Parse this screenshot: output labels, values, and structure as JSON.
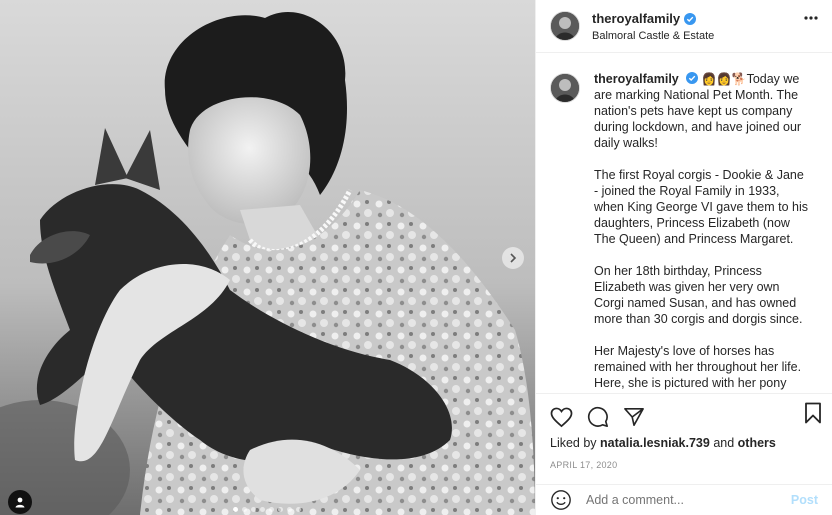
{
  "header": {
    "username": "theroyalfamily",
    "location": "Balmoral Castle & Estate"
  },
  "caption": {
    "username": "theroyalfamily",
    "emojis": "👩👩🐕",
    "p1": "Today we are marking National Pet Month. The nation's pets have kept us company during lockdown, and have joined our daily walks!",
    "p2": "The first Royal corgis - Dookie & Jane - joined the Royal Family in 1933, when King George VI gave them to his daughters, Princess Elizabeth (now The Queen) and Princess Margaret.",
    "p3": "On her 18th birthday, Princess Elizabeth was given her very own Corgi named Susan, and has owned more than 30 corgis and dorgis since.",
    "p4": "Her Majesty's love of horses has remained with her throughout her life. Here, she is pictured with her pony"
  },
  "likes": {
    "prefix": "Liked by",
    "user": "natalia.lesniak.739",
    "joiner": "and",
    "others": "others"
  },
  "date": "APRIL 17, 2020",
  "comment": {
    "placeholder": "Add a comment...",
    "post_label": "Post"
  },
  "icons": {
    "like": "heart-icon",
    "comment": "comment-icon",
    "share": "share-icon",
    "save": "bookmark-icon",
    "emoji": "emoji-icon",
    "more": "more-icon",
    "next": "chevron-right-icon",
    "tag": "user-tag-icon"
  },
  "carousel": {
    "count": 8,
    "active": 1
  },
  "colors": {
    "verified": "#3897f0",
    "post_disabled": "#b2dffc",
    "muted": "#8e8e8e"
  }
}
